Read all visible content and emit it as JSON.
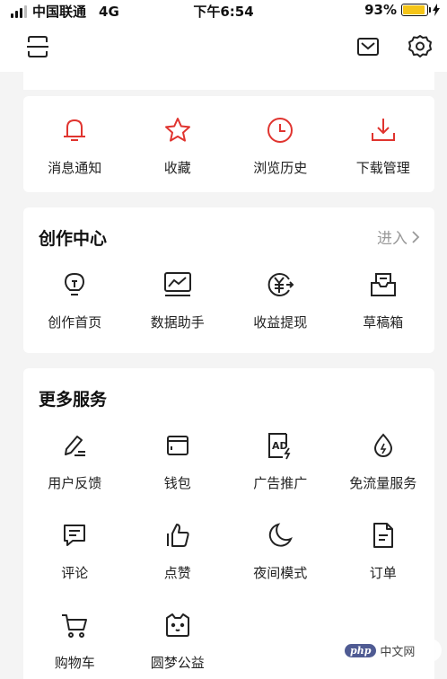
{
  "status_bar": {
    "carrier": "中国联通",
    "network": "4G",
    "time": "下午6:54",
    "battery_percent": "93%",
    "battery_level": 0.93
  },
  "top_nav": {
    "left_icon": "scan-icon",
    "right_icons": [
      "mail-icon",
      "gear-icon"
    ]
  },
  "quick_actions": [
    {
      "label": "消息通知",
      "icon": "bell-icon"
    },
    {
      "label": "收藏",
      "icon": "star-icon"
    },
    {
      "label": "浏览历史",
      "icon": "clock-icon"
    },
    {
      "label": "下载管理",
      "icon": "download-icon"
    }
  ],
  "creation_center": {
    "title": "创作中心",
    "enter_label": "进入",
    "items": [
      {
        "label": "创作首页",
        "icon": "lightbulb-icon"
      },
      {
        "label": "数据助手",
        "icon": "chart-icon"
      },
      {
        "label": "收益提现",
        "icon": "yuan-withdraw-icon"
      },
      {
        "label": "草稿箱",
        "icon": "draft-box-icon"
      }
    ]
  },
  "more_services": {
    "title": "更多服务",
    "items": [
      {
        "label": "用户反馈",
        "icon": "pen-icon"
      },
      {
        "label": "钱包",
        "icon": "wallet-icon"
      },
      {
        "label": "广告推广",
        "icon": "ad-icon"
      },
      {
        "label": "免流量服务",
        "icon": "drop-icon"
      },
      {
        "label": "评论",
        "icon": "comment-icon"
      },
      {
        "label": "点赞",
        "icon": "thumbs-up-icon"
      },
      {
        "label": "夜间模式",
        "icon": "moon-icon"
      },
      {
        "label": "订单",
        "icon": "document-icon"
      },
      {
        "label": "购物车",
        "icon": "cart-icon"
      },
      {
        "label": "圆梦公益",
        "icon": "cat-face-icon"
      }
    ]
  },
  "watermark": {
    "badge": "php",
    "text": "中文网"
  },
  "colors": {
    "accent_red": "#e0342f",
    "icon_dark": "#222222",
    "muted": "#999999"
  }
}
